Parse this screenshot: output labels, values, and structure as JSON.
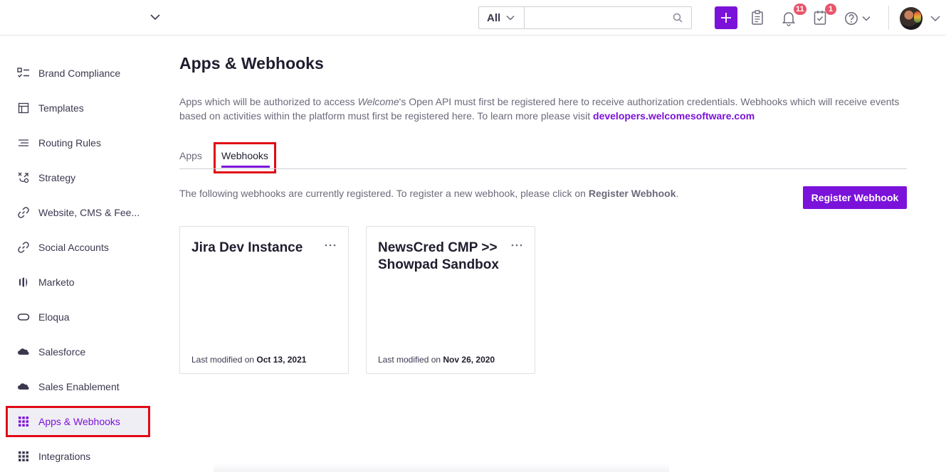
{
  "topbar": {
    "search_scope": "All",
    "search_placeholder": "",
    "notifications_count": "11",
    "tasks_count": "1",
    "accent_color": "#7b12d9",
    "badge_color": "#e8566b"
  },
  "sidebar": {
    "items": [
      {
        "label": "Brand Compliance",
        "icon": "checklist-icon"
      },
      {
        "label": "Templates",
        "icon": "template-icon"
      },
      {
        "label": "Routing Rules",
        "icon": "routing-icon"
      },
      {
        "label": "Strategy",
        "icon": "strategy-icon"
      },
      {
        "label": "Website, CMS & Fee...",
        "icon": "link-icon"
      },
      {
        "label": "Social Accounts",
        "icon": "link-icon"
      },
      {
        "label": "Marketo",
        "icon": "marketo-icon"
      },
      {
        "label": "Eloqua",
        "icon": "eloqua-icon"
      },
      {
        "label": "Salesforce",
        "icon": "cloud-icon"
      },
      {
        "label": "Sales Enablement",
        "icon": "cloud-icon"
      },
      {
        "label": "Apps & Webhooks",
        "icon": "grid-icon",
        "active": true
      },
      {
        "label": "Integrations",
        "icon": "grid-icon"
      }
    ]
  },
  "main": {
    "title": "Apps & Webhooks",
    "intro_part1": "Apps which will be authorized to access ",
    "intro_em": "Welcome",
    "intro_part2": "'s Open API must first be registered here to receive authorization credentials. Webhooks which will receive events based on activities within the platform must first be registered here. To learn more please visit ",
    "intro_link": "developers.welcomesoftware.com",
    "tabs": [
      {
        "label": "Apps",
        "active": false
      },
      {
        "label": "Webhooks",
        "active": true
      }
    ],
    "desc_text": "The following webhooks are currently registered. To register a new webhook, please click on ",
    "desc_bold": "Register Webhook",
    "desc_end": ".",
    "register_button": "Register Webhook",
    "cards": [
      {
        "title": "Jira Dev Instance",
        "modified_prefix": "Last modified on ",
        "modified_date": "Oct 13, 2021"
      },
      {
        "title": "NewsCred CMP >> Showpad Sandbox",
        "modified_prefix": "Last modified on ",
        "modified_date": "Nov 26, 2020"
      }
    ]
  }
}
